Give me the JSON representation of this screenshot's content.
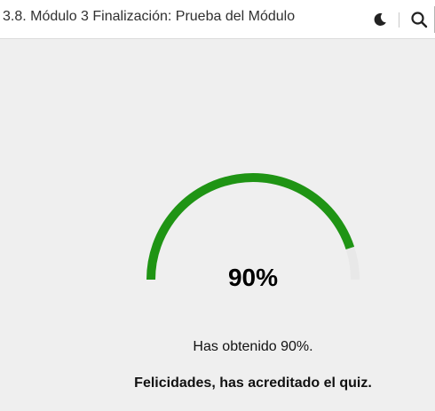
{
  "header": {
    "title": "3.8. Módulo 3 Finalización: Prueba del Módulo",
    "icons": [
      "moon-icon",
      "search-icon"
    ]
  },
  "score": {
    "value": 90,
    "label": "90%",
    "result_text": "Has obtenido 90%.",
    "message": "Felicidades, has acreditado el quiz."
  },
  "colors": {
    "gauge_fill": "#1f9414",
    "gauge_track": "#e8e8e8",
    "background": "#efefef"
  }
}
